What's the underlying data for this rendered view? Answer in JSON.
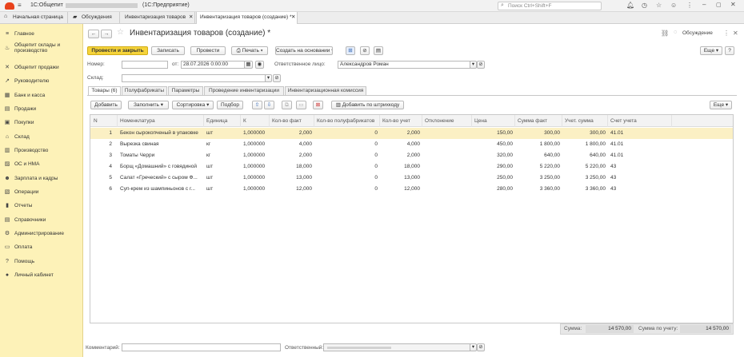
{
  "titlebar": {
    "app_name": "1С:Общепит",
    "app_context": "(1С:Предприятие)",
    "search_placeholder": "Поиск Ctrl+Shift+F"
  },
  "tabs": [
    {
      "label": "Начальная страница"
    },
    {
      "label": "Обсуждения"
    },
    {
      "label": "Инвентаризация товаров"
    },
    {
      "label": "Инвентаризация товаров (создание) *"
    }
  ],
  "sidebar": {
    "items": [
      {
        "label": "Главное",
        "icon": "menu-icon",
        "glyph": "≡"
      },
      {
        "label": "Общепит склады и производство",
        "icon": "chef-icon",
        "glyph": "♨"
      },
      {
        "label": "Общепит продажи",
        "icon": "cutlery-icon",
        "glyph": "✕"
      },
      {
        "label": "Руководителю",
        "icon": "chart-icon",
        "glyph": "↗"
      },
      {
        "label": "Банк и касса",
        "icon": "bank-icon",
        "glyph": "▦"
      },
      {
        "label": "Продажи",
        "icon": "sales-icon",
        "glyph": "▤"
      },
      {
        "label": "Покупки",
        "icon": "cart-icon",
        "glyph": "▣"
      },
      {
        "label": "Склад",
        "icon": "warehouse-icon",
        "glyph": "⌂"
      },
      {
        "label": "Производство",
        "icon": "production-icon",
        "glyph": "▥"
      },
      {
        "label": "ОС и НМА",
        "icon": "assets-icon",
        "glyph": "▨"
      },
      {
        "label": "Зарплата и кадры",
        "icon": "people-icon",
        "glyph": "☻"
      },
      {
        "label": "Операции",
        "icon": "operations-icon",
        "glyph": "▧"
      },
      {
        "label": "Отчеты",
        "icon": "reports-icon",
        "glyph": "▮"
      },
      {
        "label": "Справочники",
        "icon": "catalogs-icon",
        "glyph": "▤"
      },
      {
        "label": "Администрирование",
        "icon": "gear-icon",
        "glyph": "⚙"
      },
      {
        "label": "Оплата",
        "icon": "payment-icon",
        "glyph": "▭"
      },
      {
        "label": "Помощь",
        "icon": "help-icon",
        "glyph": "?"
      },
      {
        "label": "Личный кабинет",
        "icon": "account-icon",
        "glyph": "●"
      }
    ]
  },
  "form": {
    "title": "Инвентаризация товаров (создание) *",
    "discussion": "Обсуждение",
    "toolbar": {
      "post_close": "Провести и закрыть",
      "write": "Записать",
      "post": "Провести",
      "print": "Печать",
      "create_based": "Создать на основании",
      "more": "Еще"
    },
    "fields": {
      "number_label": "Номер:",
      "number_value": "",
      "date_from_label": "от:",
      "date_value": "28.07.2026  0:00:00",
      "responsible_label": "Ответственное лицо:",
      "responsible_value": "Александров Роман",
      "warehouse_label": "Склад:",
      "warehouse_value": ""
    },
    "form_tabs": [
      "Товары (6)",
      "Полуфабрикаты",
      "Параметры",
      "Проведение инвентаризации",
      "Инвентаризационная комиссия"
    ],
    "table_toolbar": {
      "add": "Добавить",
      "fill": "Заполнить",
      "sort": "Сортировка",
      "select": "Подбор",
      "barcode": "Добавить по штрихкоду",
      "more": "Еще"
    },
    "columns": [
      "N",
      "Номенклатура",
      "Единица",
      "К",
      "Кол-во факт",
      "Кол-во полуфабрикатов",
      "Кол-во учет",
      "Отклонение",
      "Цена",
      "Сумма факт",
      "Учет. сумма",
      "Счет учета"
    ],
    "rows": [
      {
        "n": "1",
        "name": "Бекон сырокопченый в упаковке",
        "unit": "шт",
        "k": "1,000000",
        "qty_fact": "2,000",
        "qty_semi": "0",
        "qty_acc": "2,000",
        "dev": "",
        "price": "150,00",
        "sum_fact": "300,00",
        "sum_acc": "300,00",
        "account": "41.01"
      },
      {
        "n": "2",
        "name": "Вырезка свиная",
        "unit": "кг",
        "k": "1,000000",
        "qty_fact": "4,000",
        "qty_semi": "0",
        "qty_acc": "4,000",
        "dev": "",
        "price": "450,00",
        "sum_fact": "1 800,00",
        "sum_acc": "1 800,00",
        "account": "41.01"
      },
      {
        "n": "3",
        "name": "Томаты Черри",
        "unit": "кг",
        "k": "1,000000",
        "qty_fact": "2,000",
        "qty_semi": "0",
        "qty_acc": "2,000",
        "dev": "",
        "price": "320,00",
        "sum_fact": "640,00",
        "sum_acc": "640,00",
        "account": "41.01"
      },
      {
        "n": "4",
        "name": "Борщ «Домашний» с говядиной",
        "unit": "шт",
        "k": "1,000000",
        "qty_fact": "18,000",
        "qty_semi": "0",
        "qty_acc": "18,000",
        "dev": "",
        "price": "290,00",
        "sum_fact": "5 220,00",
        "sum_acc": "5 220,00",
        "account": "43"
      },
      {
        "n": "5",
        "name": "Салат «Греческий» с сыром Ф...",
        "unit": "шт",
        "k": "1,000000",
        "qty_fact": "13,000",
        "qty_semi": "0",
        "qty_acc": "13,000",
        "dev": "",
        "price": "250,00",
        "sum_fact": "3 250,00",
        "sum_acc": "3 250,00",
        "account": "43"
      },
      {
        "n": "6",
        "name": "Суп-крем из шампиньонов с г...",
        "unit": "шт",
        "k": "1,000000",
        "qty_fact": "12,000",
        "qty_semi": "0",
        "qty_acc": "12,000",
        "dev": "",
        "price": "280,00",
        "sum_fact": "3 360,00",
        "sum_acc": "3 360,00",
        "account": "43"
      }
    ],
    "totals": {
      "sum_label": "Сумма:",
      "sum_value": "14 570,00",
      "sum_acc_label": "Сумма по учету:",
      "sum_acc_value": "14 570,00"
    },
    "footer": {
      "comment_label": "Комментарий:",
      "comment_value": "",
      "responsible_label": "Ответственный:",
      "responsible_value": ""
    }
  },
  "colors": {
    "accent": "#f5d33a",
    "sidebar": "#fdf2b8",
    "selected_row": "#fbf0c4"
  }
}
